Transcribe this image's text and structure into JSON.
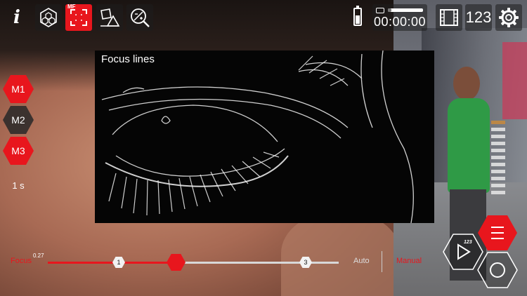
{
  "toolbar": {
    "info_glyph": "i",
    "mf_badge": "MF",
    "count_label": "123",
    "battery_level": 0.6
  },
  "recording": {
    "timecode": "00:00:00",
    "storage_used": 0.1
  },
  "focus_overlay": {
    "title": "Focus lines"
  },
  "memory_buttons": [
    {
      "label": "M1",
      "active": true
    },
    {
      "label": "M2",
      "active": false
    },
    {
      "label": "M3",
      "active": true
    }
  ],
  "duration_label": "1 s",
  "focus_slider": {
    "label": "Focus",
    "value": "0.27",
    "markers": [
      "1",
      "3"
    ],
    "auto_label": "Auto",
    "manual_label": "Manual"
  },
  "bottom_controls": {
    "play_badge": "123"
  },
  "colors": {
    "accent": "#e8161d",
    "panel": "#1e1e1e"
  },
  "icons": [
    "info-icon",
    "hexagon-cluster-icon",
    "manual-focus-icon",
    "shapes-icon",
    "exposure-search-icon",
    "battery-icon",
    "film-icon",
    "gear-icon",
    "menu-icon",
    "play-icon",
    "record-icon"
  ]
}
